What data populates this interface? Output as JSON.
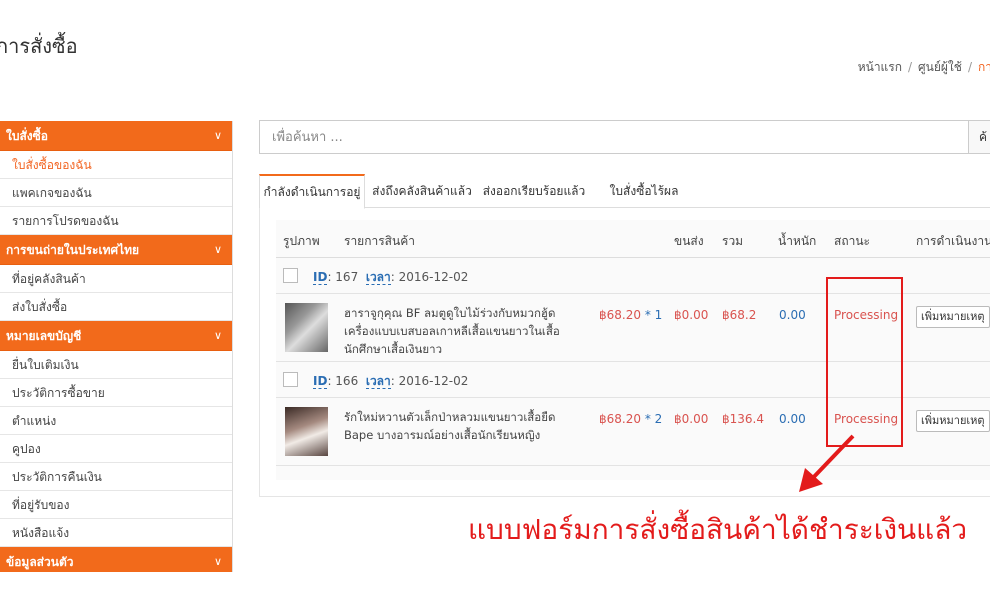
{
  "page": {
    "title": "การสั่งซื้อ"
  },
  "breadcrumb": {
    "items": [
      "หน้าแรก",
      "ศูนย์ผู้ใช้",
      "กา"
    ]
  },
  "sidebar": {
    "sections": [
      {
        "title": "ใบสั่งซื้อ",
        "items": [
          "ใบสั่งซื้อของฉัน",
          "แพคเกจของฉัน",
          "รายการโปรดของฉัน"
        ],
        "active_index": 0
      },
      {
        "title": "การขนถ่ายในประเทศไทย",
        "items": [
          "ที่อยู่คลังสินค้า",
          "ส่งใบสั่งซื้อ"
        ]
      },
      {
        "title": "หมายเลขบัญชี",
        "items": [
          "ยื่นใบเติมเงิน",
          "ประวัติการซื้อขาย",
          "ตำแหน่ง",
          "คูปอง",
          "ประวัติการคืนเงิน",
          "ที่อยู่รับของ",
          "หนังสือแจ้ง"
        ]
      },
      {
        "title": "ข้อมูลส่วนตัว",
        "items": []
      }
    ]
  },
  "search": {
    "placeholder": "เพื่อค้นหา ...",
    "button_label": "ค้"
  },
  "tabs": [
    "กำลังดำเนินการอยู่",
    "ส่งถึงคลังสินค้าแล้ว",
    "ส่งออกเรียบร้อยแล้ว",
    "ใบสั่งซื้อไร้ผล"
  ],
  "table": {
    "headers": [
      "รูปภาพ",
      "รายการสินค้า",
      "ขนส่ง",
      "รวม",
      "น้ำหนัก",
      "สถานะ",
      "การดำเนินงาน"
    ],
    "groups": [
      {
        "id_label": "ID",
        "id": ": 167",
        "time_label": "เวลา",
        "time": ": 2016-12-02",
        "item": {
          "name": "ฮาราจูกุคุณ BF ลมตูดูใบไม้ร่วงกับหมวกฮู้ดเครื่องแบบเบสบอลเกาหลีเสื้อแขนยาวในเสื้อนักศึกษาเสื้อเงินยาว",
          "price": "฿68.20",
          "qty": " * 1",
          "shipping": "฿0.00",
          "total": "฿68.2",
          "weight": "0.00",
          "status": "Processing",
          "action": "เพิ่มหมายเหตุ"
        }
      },
      {
        "id_label": "ID",
        "id": ": 166",
        "time_label": "เวลา",
        "time": ": 2016-12-02",
        "item": {
          "name": "รักใหม่หวานตัวเล็กป่าหลวมแขนยาวเสื้อยืด Bape บางอารมณ์อย่างเสื้อนักเรียนหญิง",
          "price": "฿68.20",
          "qty": " * 2",
          "shipping": "฿0.00",
          "total": "฿136.4",
          "weight": "0.00",
          "status": "Processing",
          "action": "เพิ่มหมายเหตุ"
        }
      }
    ]
  },
  "annotation": {
    "text": "แบบฟอร์มการสั่งซื้อสินค้าได้ชำระเงินแล้ว",
    "color": "#e31b1b"
  },
  "colors": {
    "accent": "#f26a1b",
    "price": "#d9534f",
    "link": "#2a6db3"
  }
}
